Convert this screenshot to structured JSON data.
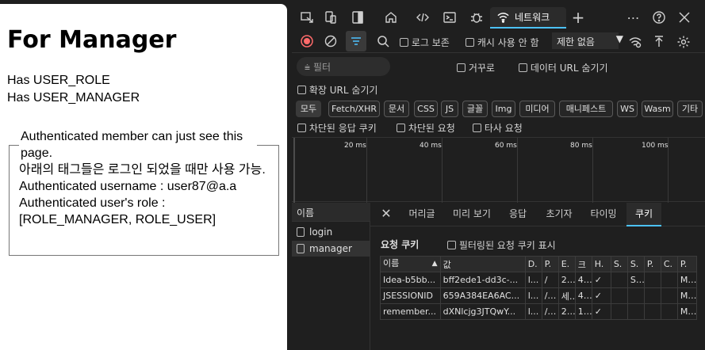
{
  "page": {
    "title": "For Manager",
    "roles": [
      "Has USER_ROLE",
      "Has USER_MANAGER"
    ],
    "box": {
      "legend": "Authenticated member can just see this page.",
      "lines": [
        "아래의 태그들은 로그인 되었을 때만 사용 가능.",
        "Authenticated username : user87@a.a",
        "Authenticated user's role : [ROLE_MANAGER, ROLE_USER]"
      ]
    }
  },
  "devtools": {
    "network_tab": "네트워크",
    "toolbar": {
      "preserve_log": "로그 보존",
      "disable_cache": "캐시 사용 안 함",
      "throttle": "제한 없음"
    },
    "filter": {
      "placeholder": "필터",
      "invert": "거꾸로",
      "hide_data_urls": "데이터 URL 숨기기",
      "hide_ext_urls": "확장 URL 숨기기",
      "blocked_cookies": "차단된 응답 쿠키",
      "blocked_requests": "차단된 요청",
      "third_party": "타사 요청"
    },
    "type_filters": [
      "모두",
      "Fetch/XHR",
      "문서",
      "CSS",
      "JS",
      "글꼴",
      "Img",
      "미디어",
      "매니페스트",
      "WS",
      "Wasm",
      "기타"
    ],
    "timeline_labels": [
      "20 ms",
      "40 ms",
      "60 ms",
      "80 ms",
      "100 ms"
    ],
    "name_header": "이름",
    "requests": [
      "login",
      "manager"
    ],
    "detail_tabs": [
      "머리글",
      "미리 보기",
      "응답",
      "초기자",
      "타이밍",
      "쿠키"
    ],
    "cookies": {
      "section_title": "요청 쿠키",
      "show_filtered": "필터링된 요청 쿠키 표시",
      "columns": [
        "이름",
        "값",
        "D.",
        "P.",
        "E.",
        "크",
        "H.",
        "S.",
        "S.",
        "P.",
        "C.",
        "P."
      ],
      "rows": [
        [
          "Idea-b5bb...",
          "bff2ede1-dd3c-...",
          "l...",
          "/",
          "2...",
          "4...",
          "✓",
          "",
          "S...",
          "",
          "",
          "M..."
        ],
        [
          "JSESSIONID",
          "659A384EA6AC...",
          "l...",
          "/...",
          "세...",
          "4...",
          "✓",
          "",
          "",
          "",
          "",
          "M..."
        ],
        [
          "remember...",
          "dXNlcjg3JTQwY...",
          "l...",
          "/...",
          "2...",
          "1...",
          "✓",
          "",
          "",
          "",
          "",
          "M..."
        ]
      ]
    }
  }
}
